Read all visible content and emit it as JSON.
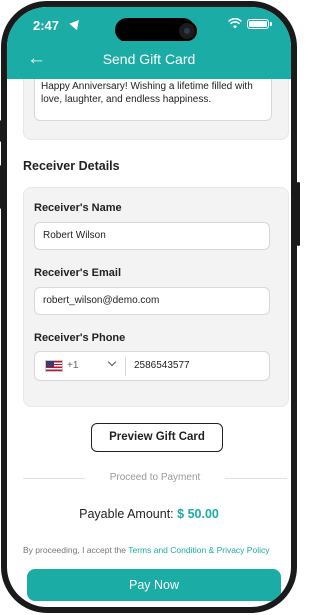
{
  "status_bar": {
    "time": "2:47"
  },
  "app_bar": {
    "title": "Send Gift Card"
  },
  "message": {
    "text": "Happy Anniversary! Wishing a lifetime filled with love, laughter, and endless happiness."
  },
  "receiver": {
    "section_title": "Receiver Details",
    "name_label": "Receiver's Name",
    "name_value": "Robert Wilson",
    "email_label": "Receiver's Email",
    "email_value": "robert_wilson@demo.com",
    "phone_label": "Receiver's Phone",
    "country_code": "+1",
    "phone_value": "2586543577"
  },
  "preview_button": "Preview Gift Card",
  "proceed_label": "Proceed to Payment",
  "payable": {
    "label": "Payable Amount:",
    "amount": "$ 50.00"
  },
  "terms": {
    "prefix": "By proceeding, I accept the ",
    "link": "Terms and Condition & Privacy Policy"
  },
  "pay_button": "Pay Now",
  "colors": {
    "accent": "#1aaca5",
    "card_bg": "#f3f3f3"
  }
}
